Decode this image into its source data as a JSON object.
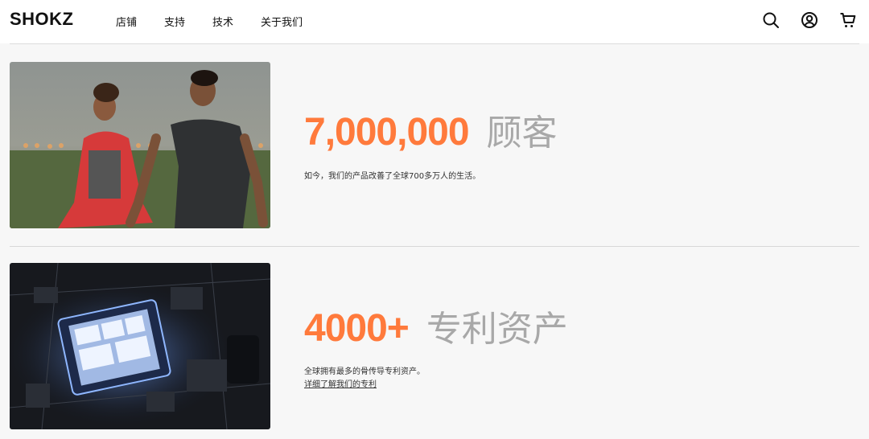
{
  "header": {
    "logo_text": "SHOKZ",
    "nav": [
      {
        "label": "店铺"
      },
      {
        "label": "支持"
      },
      {
        "label": "技术"
      },
      {
        "label": "关于我们"
      }
    ],
    "icons": [
      "search-icon",
      "account-icon",
      "cart-icon"
    ]
  },
  "sections": [
    {
      "image": "runners-photo",
      "number": "7,000,000",
      "label": "顾客",
      "description": "如今，我们的产品改善了全球700多万人的生活。"
    },
    {
      "image": "chip-photo",
      "number": "4000+",
      "label": "专利资产",
      "description": "全球拥有最多的骨传导专利资产。",
      "link": "详细了解我们的专利"
    }
  ],
  "colors": {
    "accent": "#ff7a3c",
    "label_gray": "#a8a8a8",
    "background": "#f7f7f7"
  }
}
